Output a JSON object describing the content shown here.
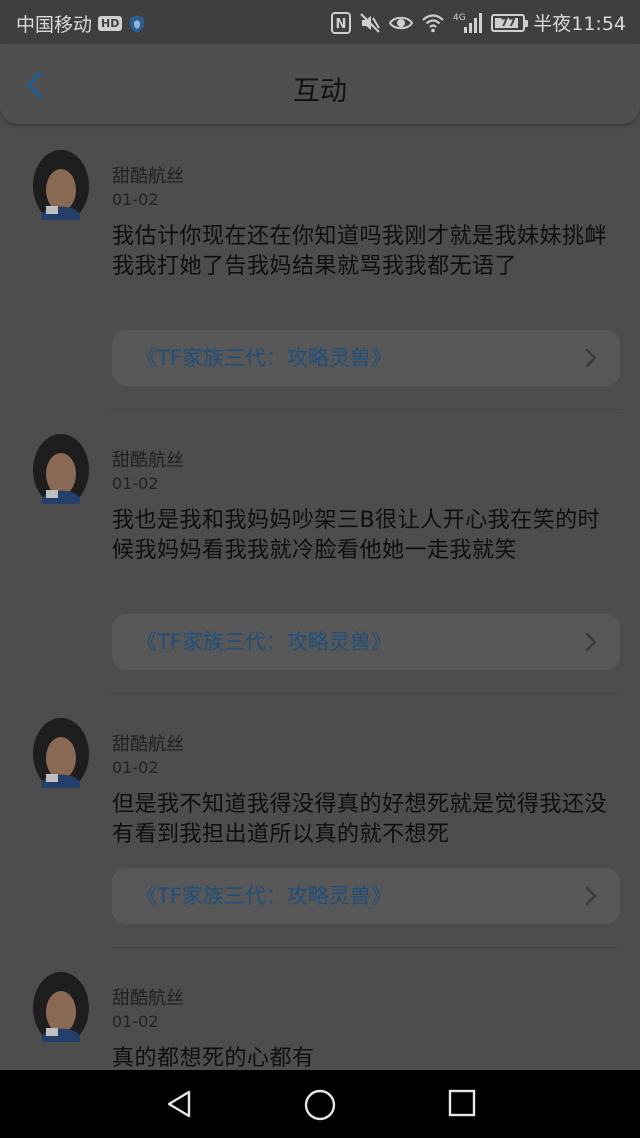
{
  "status_bar": {
    "carrier": "中国移动",
    "hd_badge": "HD",
    "network_label": "4G",
    "battery_level": "77",
    "time": "半夜11:54",
    "icons": [
      "shield-icon",
      "nfc-icon",
      "mute-icon",
      "eye-icon",
      "wifi-icon",
      "signal-icon",
      "battery-icon"
    ]
  },
  "header": {
    "title": "互动",
    "back_icon": "chevron-left-icon",
    "accent_color": "#1f5d95"
  },
  "posts": [
    {
      "author": "甜酷航丝",
      "date": "01-02",
      "text": "我估计你现在还在你知道吗我刚才就是我妹妹挑衅我我打她了告我妈结果就骂我我都无语了",
      "link": "《TF家族三代：攻略灵兽》"
    },
    {
      "author": "甜酷航丝",
      "date": "01-02",
      "text": "我也是我和我妈妈吵架三B很让人开心我在笑的时候我妈妈看我我就冷脸看他她一走我就笑",
      "link": "《TF家族三代：攻略灵兽》"
    },
    {
      "author": "甜酷航丝",
      "date": "01-02",
      "text": "但是我不知道我得没得真的好想死就是觉得我还没有看到我担出道所以真的就不想死",
      "link": "《TF家族三代：攻略灵兽》"
    },
    {
      "author": "甜酷航丝",
      "date": "01-02",
      "text": "真的都想死的心都有",
      "link": ""
    }
  ],
  "system_nav": {
    "icons": [
      "back-triangle-icon",
      "home-circle-icon",
      "recents-square-icon"
    ]
  }
}
